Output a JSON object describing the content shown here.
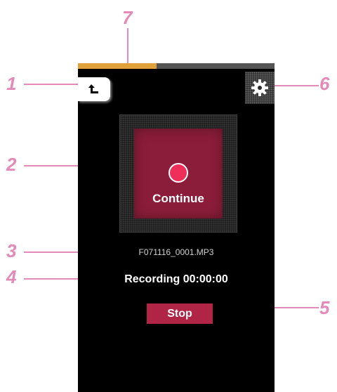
{
  "callouts": [
    "1",
    "2",
    "3",
    "4",
    "5",
    "6",
    "7"
  ],
  "progress": {
    "fraction": 0.4
  },
  "record": {
    "label": "Continue"
  },
  "file": {
    "name": "F071116_0001.MP3"
  },
  "status": {
    "text": "Recording 00:00:00"
  },
  "stop": {
    "label": "Stop"
  },
  "icons": {
    "back": "back-arrow-icon",
    "settings": "gear-icon",
    "record": "record-dot-icon"
  },
  "colors": {
    "callout": "#e48ab8",
    "progress": "#e0a03a",
    "record_button": "#8c1d3a",
    "record_dot": "#ee2f5a",
    "stop_button": "#b02545"
  }
}
